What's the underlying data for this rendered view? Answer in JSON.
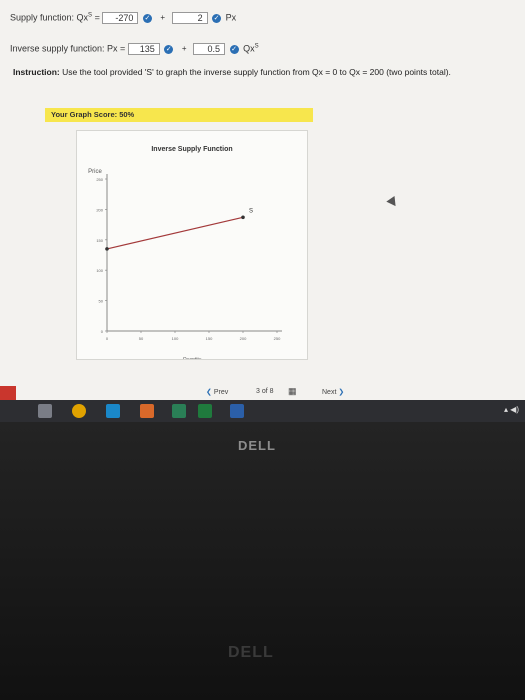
{
  "supply_function": {
    "label": "Supply function: Qx",
    "superscript": "S",
    "eq": "=",
    "intercept": "-270",
    "plus": "+",
    "slope": "2",
    "var": "Px"
  },
  "inverse_supply": {
    "label": "Inverse supply function: Px =",
    "intercept": "135",
    "plus": "+",
    "slope": "0.5",
    "var": "Qx",
    "superscript": "S"
  },
  "instruction": {
    "bold": "Instruction:",
    "text": "Use the tool provided 'S' to graph the inverse supply function from Qx = 0 to Qx = 200 (two points total)."
  },
  "score": {
    "label": "Your Graph Score: 50%"
  },
  "chart_data": {
    "type": "line",
    "title": "Inverse Supply Function",
    "ylabel": "Price",
    "xlabel": "Quantity",
    "xlim": [
      0,
      250
    ],
    "ylim": [
      0,
      250
    ],
    "x_ticks": [
      "0",
      "50",
      "100",
      "150",
      "200",
      "250"
    ],
    "y_ticks": [
      "0",
      "50",
      "100",
      "150",
      "200",
      "250"
    ],
    "series": [
      {
        "name": "S",
        "points": [
          [
            0,
            135
          ],
          [
            200,
            187
          ]
        ],
        "color": "#a3393a"
      }
    ],
    "grid": false
  },
  "pager": {
    "prev": "Prev",
    "position": "3 of 8",
    "next": "Next"
  },
  "taskbar": {
    "tray": "▴ ◀)"
  },
  "monitor": {
    "brand": "DELL"
  },
  "colors": {
    "accent": "#2b6fb4",
    "score_bg": "#f7e64d",
    "line": "#a3393a"
  }
}
